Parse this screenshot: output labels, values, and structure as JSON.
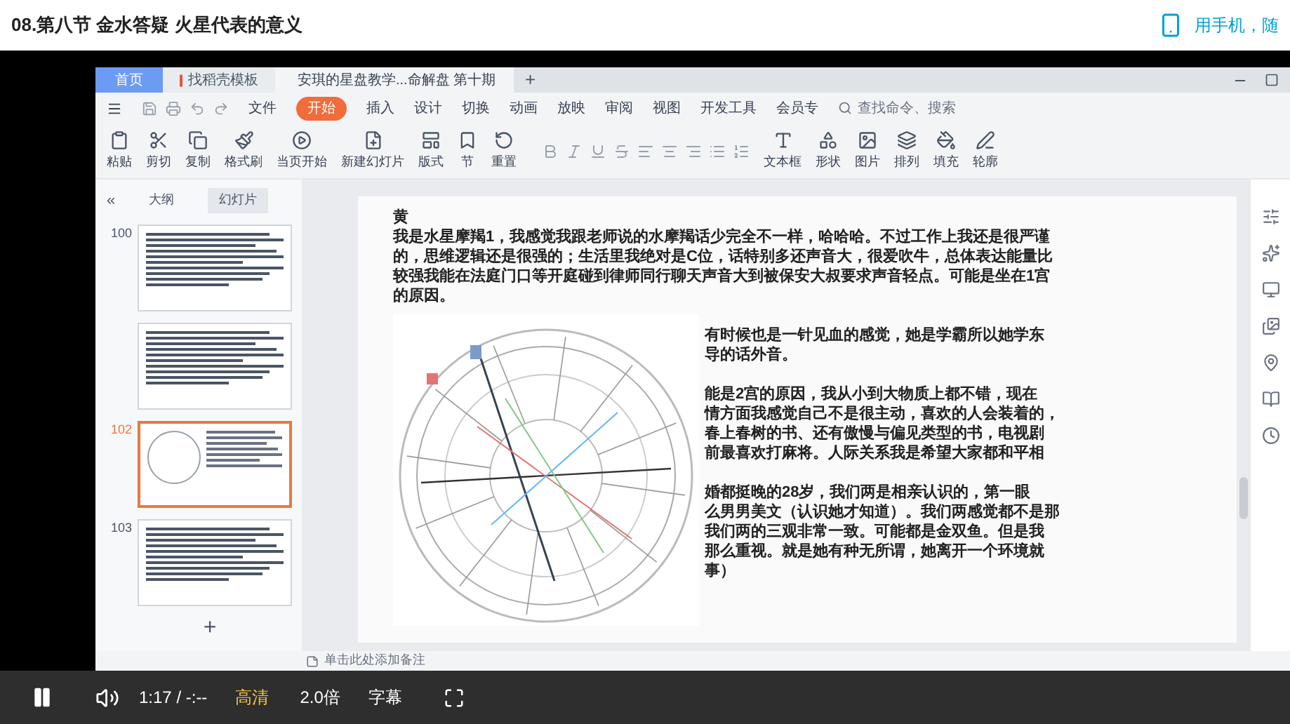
{
  "page_title": "08.第八节 金水答疑 火星代表的意义",
  "mobile_link": "用手机，随",
  "wps": {
    "tabs": [
      {
        "label": "首页",
        "kind": "home",
        "selected": false
      },
      {
        "label": "找稻壳模板",
        "kind": "template",
        "selected": false
      },
      {
        "label": "安琪的星盘教学...命解盘 第十期",
        "kind": "doc",
        "selected": true
      }
    ],
    "new_tab": "+",
    "menu": [
      {
        "label": "文件",
        "selected": false
      },
      {
        "label": "开始",
        "selected": true
      },
      {
        "label": "插入",
        "selected": false
      },
      {
        "label": "设计",
        "selected": false
      },
      {
        "label": "切换",
        "selected": false
      },
      {
        "label": "动画",
        "selected": false
      },
      {
        "label": "放映",
        "selected": false
      },
      {
        "label": "审阅",
        "selected": false
      },
      {
        "label": "视图",
        "selected": false
      },
      {
        "label": "开发工具",
        "selected": false
      },
      {
        "label": "会员专",
        "selected": false
      }
    ],
    "search_placeholder": "查找命令、搜索",
    "ribbon_left": [
      {
        "label": "粘贴"
      },
      {
        "label": "剪切"
      },
      {
        "label": "复制"
      },
      {
        "label": "格式刷"
      },
      {
        "label": "当页开始"
      },
      {
        "label": "新建幻灯片"
      },
      {
        "label": "版式"
      },
      {
        "label": "节"
      },
      {
        "label": "重置"
      }
    ],
    "ribbon_right": [
      {
        "label": "文本框"
      },
      {
        "label": "形状"
      },
      {
        "label": "图片"
      },
      {
        "label": "排列"
      },
      {
        "label": "填充"
      },
      {
        "label": "轮廓"
      }
    ],
    "collapse": "«",
    "panel_tabs": [
      {
        "label": "大纲",
        "selected": false
      },
      {
        "label": "幻灯片",
        "selected": true
      }
    ],
    "slides": [
      {
        "number": "100",
        "selected": false,
        "kind": "text"
      },
      {
        "selected": false,
        "kind": "text"
      },
      {
        "number": "102",
        "selected": true,
        "kind": "chart"
      },
      {
        "number": "103",
        "selected": false,
        "kind": "text"
      }
    ],
    "add_slide": "+",
    "slide": {
      "heading": "黄",
      "intro": "我是水星摩羯1，我感觉我跟老师说的水摩羯话少完全不一样，哈哈哈。不过工作上我还是很严谨的，思维逻辑还是很强的；生活里我绝对是C位，话特别多还声音大，很爱吹牛，总体表达能量比较强我能在法庭门口等开庭碰到律师同行聊天声音大到被保安大叔要求声音轻点。可能是坐在1宫的原因。",
      "paragraphs": [
        {
          "lines": [
            "有时候也是一针见血的感觉，她是学霸所以她学东",
            "导的话外音。"
          ]
        },
        {
          "lines": [
            "能是2宫的原因，我从小到大物质上都不错，现在",
            "情方面我感觉自己不是很主动，喜欢的人会装着的，",
            "春上春树的书、还有傲慢与偏见类型的书，电视剧",
            "前最喜欢打麻将。人际关系我是希望大家都和平相"
          ]
        },
        {
          "lines": [
            "婚都挺晚的28岁，我们两是相亲认识的，第一眼",
            "么男男美文（认识她才知道）。我们两感觉都不是那",
            "我们两的三观非常一致。可能都是金双鱼。但是我",
            "那么重视。就是她有种无所谓，她离开一个环境就",
            "事）"
          ]
        }
      ]
    },
    "notes_placeholder": "单击此处添加备注"
  },
  "player": {
    "playing": true,
    "time": "1:17 / -:--",
    "quality": "高清",
    "speed": "2.0倍",
    "subtitle": "字幕"
  }
}
